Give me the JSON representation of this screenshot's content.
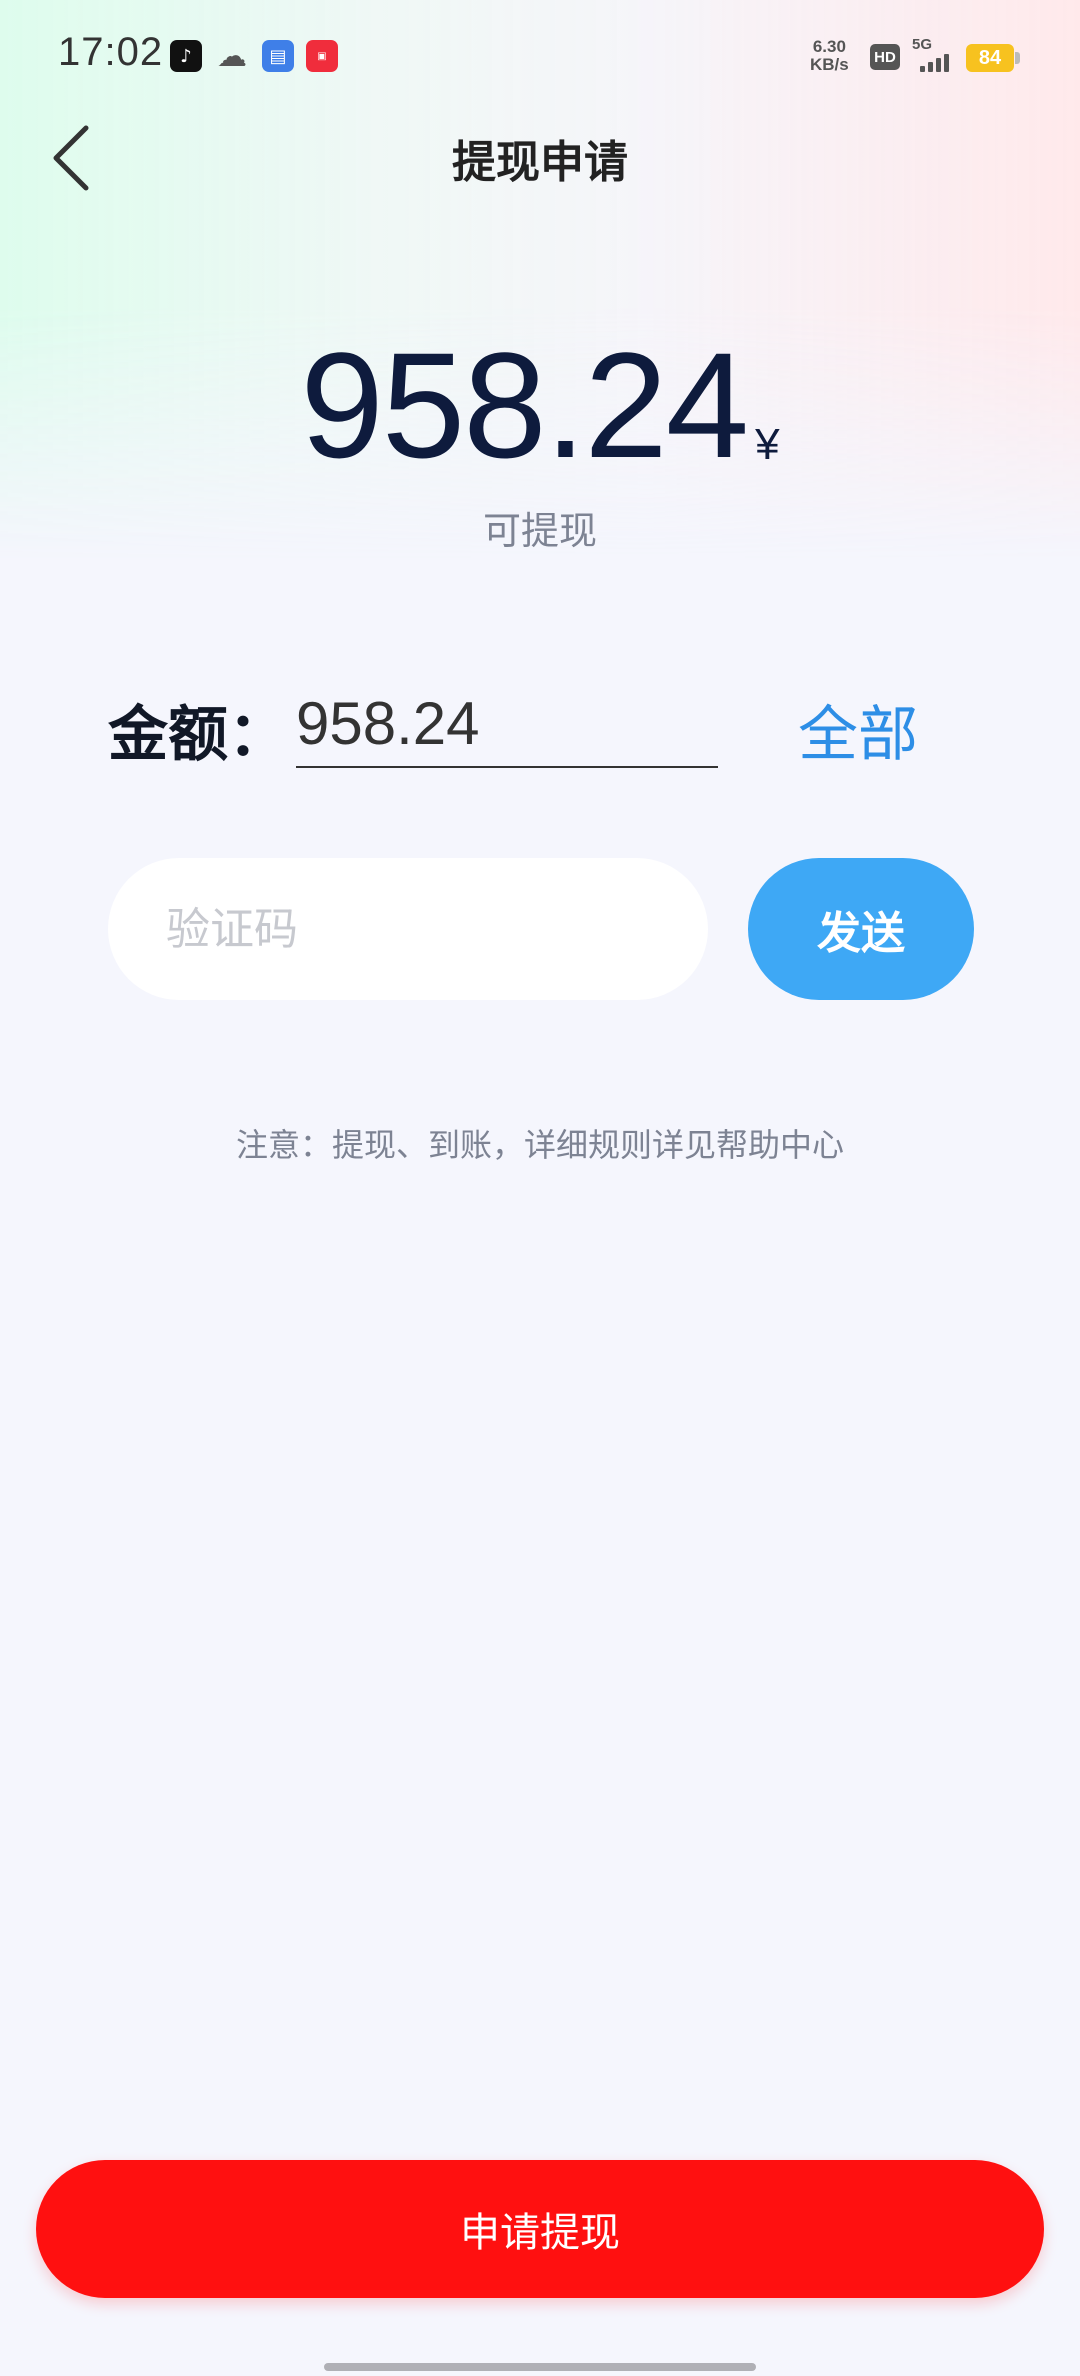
{
  "status_bar": {
    "time": "17:02",
    "net_speed_value": "6.30",
    "net_speed_unit": "KB/s",
    "hd_label": "HD",
    "network_label": "5G",
    "battery": "84",
    "app_icons": [
      "tiktok-icon",
      "wechat-icon",
      "blue-app-icon",
      "red-app-icon"
    ]
  },
  "header": {
    "title": "提现申请",
    "back_icon": "chevron-left-icon"
  },
  "balance": {
    "amount": "958.24",
    "currency": "¥",
    "label": "可提现"
  },
  "amount_row": {
    "label": "金额：",
    "value": "958.24",
    "all_label": "全部"
  },
  "verify_row": {
    "placeholder": "验证码",
    "send_label": "发送"
  },
  "notice": "注意：提现、到账，详细规则详见帮助中心",
  "submit_label": "申请提现",
  "colors": {
    "accent_blue": "#3ea8f5",
    "link_blue": "#2d8ee6",
    "submit_red": "#ff1010",
    "amount_dark": "#0e1b3d",
    "page_bg": "#f5f6fd"
  }
}
